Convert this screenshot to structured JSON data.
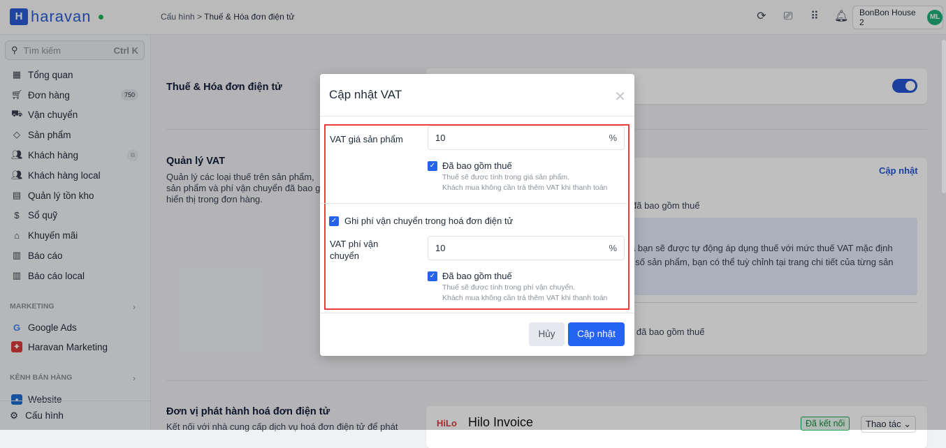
{
  "header": {
    "brand": "haravan",
    "breadcrumb": [
      "Cấu hình",
      "Thuế & Hóa đơn điện tử"
    ],
    "store": "BonBon House 2",
    "avatar": "ML"
  },
  "sidebar": {
    "search_placeholder": "Tìm kiếm",
    "search_shortcut": "Ctrl K",
    "items": [
      {
        "label": "Tổng quan",
        "icon": "dashboard-icon"
      },
      {
        "label": "Đơn hàng",
        "icon": "cart-icon",
        "badge": "750"
      },
      {
        "label": "Vận chuyển",
        "icon": "truck-icon"
      },
      {
        "label": "Sản phẩm",
        "icon": "tag-icon"
      },
      {
        "label": "Khách hàng",
        "icon": "users-icon"
      },
      {
        "label": "Khách hàng local",
        "icon": "users-icon"
      },
      {
        "label": "Quản lý tồn kho",
        "icon": "inventory-icon"
      },
      {
        "label": "Sổ quỹ",
        "icon": "dollar-icon"
      },
      {
        "label": "Khuyến mãi",
        "icon": "gift-icon"
      },
      {
        "label": "Báo cáo",
        "icon": "report-icon"
      },
      {
        "label": "Báo cáo local",
        "icon": "report-icon"
      }
    ],
    "marketing_title": "MARKETING",
    "marketing": [
      {
        "label": "Google Ads"
      },
      {
        "label": "Haravan Marketing"
      }
    ],
    "sales_title": "KÊNH BÁN HÀNG",
    "sales": [
      {
        "label": "Website"
      }
    ],
    "settings": "Cấu hình"
  },
  "main": {
    "section1_title": "Thuế & Hóa đơn điện tử",
    "vat_title": "Quản lý VAT",
    "vat_desc": [
      "Quản lý các loại thuế trên sản phẩm,",
      "sản phẩm và phí vận chuyển đã bao g",
      "hiển thị trong đơn hàng."
    ],
    "update_link": "Cập nhật",
    "row1_fragment": "đã bao gồm thuế",
    "info_fragment": [
      "a bạn sẽ được tự động áp dụng thuế với mức thuế VAT mặc định",
      "t số sản phẩm, bạn có thể tuỳ chỉnh tại trang chi tiết của từng sản"
    ],
    "row2_fragment": "n đã bao gồm thuế",
    "section3_title": "Đơn vị phát hành hoá đơn điện tử",
    "section3_desc": "Kết nối với nhà cung cấp dịch vụ hoá đơn điện tử để phát",
    "provider_logo": "HiLo",
    "provider": "Hilo Invoice",
    "connected": "Đã kết nối",
    "actions": "Thao tác"
  },
  "modal": {
    "title": "Cập nhật VAT",
    "product_vat_label": "VAT giá sản phẩm",
    "product_vat": "10",
    "unit": "%",
    "included": "Đã bao gồm thuế",
    "product_hint": [
      "Thuế sẽ được tính trong giá sản phẩm.",
      "Khách mua không cần trả thêm VAT khi thanh toán"
    ],
    "shipping_checkbox": "Ghi phí vận chuyển trong hoá đơn điện tử",
    "shipping_vat_label": [
      "VAT phí vận",
      "chuyển"
    ],
    "shipping_vat": "10",
    "shipping_hint": [
      "Thuế sẽ được tính trong phí vận chuyển.",
      "Khách mua không cần trả thêm VAT khi thanh toán"
    ],
    "cancel": "Hủy",
    "submit": "Cập nhật"
  }
}
